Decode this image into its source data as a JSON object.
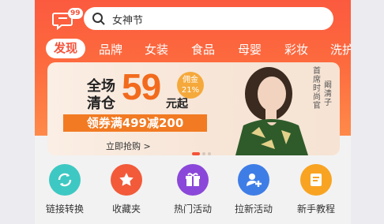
{
  "header": {
    "message_badge": "99",
    "search_placeholder": "女神节"
  },
  "tabs": [
    "发现",
    "品牌",
    "女装",
    "食品",
    "母婴",
    "彩妆",
    "洗护"
  ],
  "banner": {
    "line1": "全场",
    "line2": "清仓",
    "number": "59",
    "unit": "元起",
    "seal": "佣金\n21%",
    "strip": "领券满499减200",
    "cta": "立即抢购 >",
    "side_text_1": "首席时尚官",
    "side_text_2": "阚清子"
  },
  "shortcuts": [
    {
      "label": "链接转换",
      "icon": "link-convert-icon",
      "color": "#3ec8c3"
    },
    {
      "label": "收藏夹",
      "icon": "star-icon",
      "color": "#f25a3a"
    },
    {
      "label": "热门活动",
      "icon": "gift-icon",
      "color": "#8b47d9"
    },
    {
      "label": "拉新活动",
      "icon": "add-user-icon",
      "color": "#3f7de6"
    },
    {
      "label": "新手教程",
      "icon": "book-icon",
      "color": "#f8a422"
    }
  ]
}
